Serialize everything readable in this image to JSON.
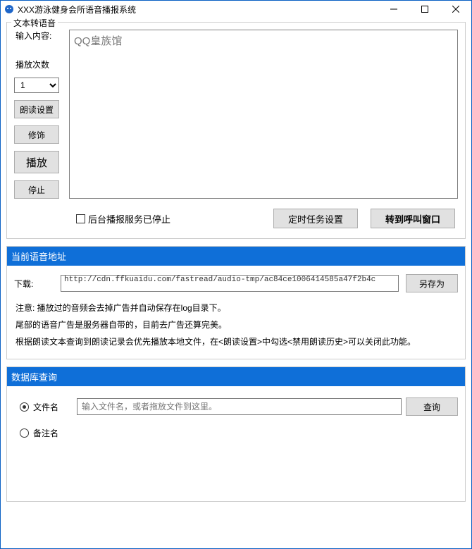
{
  "window": {
    "title": "XXX游泳健身会所语音播报系统"
  },
  "tts": {
    "legend": "文本转语音",
    "input_label": "输入内容:",
    "input_value": "QQ皇族馆",
    "count_label": "播放次数",
    "count_value": "1",
    "btn_read_settings": "朗读设置",
    "btn_decorate": "修饰",
    "btn_play": "播放",
    "btn_stop": "停止",
    "checkbox_label": "后台播报服务已停止",
    "btn_timer": "定时任务设置",
    "btn_switch": "转到呼叫窗口"
  },
  "voice_addr": {
    "header": "当前语音地址",
    "download_label": "下载:",
    "url": "http://cdn.ffkuaidu.com/fastread/audio-tmp/ac84ce1006414585a47f2b4c",
    "btn_saveas": "另存为",
    "note1": "注意: 播放过的音频会去掉广告并自动保存在log目录下。",
    "note2": "尾部的语音广告是服务器自带的，目前去广告还算完美。",
    "note3": "根据朗读文本查询到朗读记录会优先播放本地文件，在<朗读设置>中勾选<禁用朗读历史>可以关闭此功能。"
  },
  "db_query": {
    "header": "数据库查询",
    "radio_filename": "文件名",
    "radio_remark": "备注名",
    "input_placeholder": "输入文件名，或者拖放文件到这里。",
    "btn_query": "查询"
  }
}
